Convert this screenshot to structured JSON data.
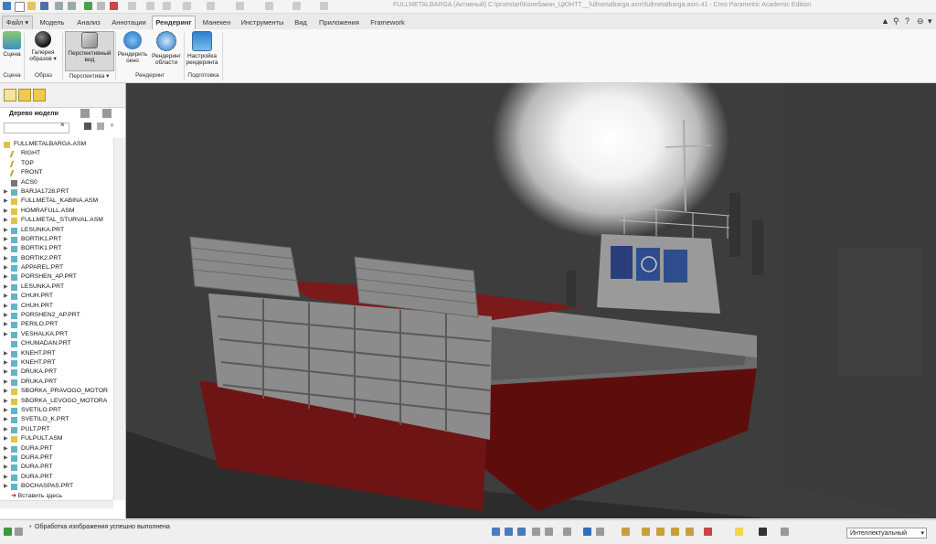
{
  "window": {
    "title": "FULLMETALBARGA (Активный) C:\\proestart\\Колебакин_ЦЮНТТ__fullmetalbarga.asm\\fullmetalbarga.asm.41 - Creo Parametric Academic Edition"
  },
  "tabs": [
    {
      "label": "Файл ▾"
    },
    {
      "label": "Модель"
    },
    {
      "label": "Анализ"
    },
    {
      "label": "Аннотации"
    },
    {
      "label": "Рендеринг"
    },
    {
      "label": "Манекен"
    },
    {
      "label": "Инструменты"
    },
    {
      "label": "Вид"
    },
    {
      "label": "Приложения"
    },
    {
      "label": "Framework"
    }
  ],
  "active_tab": "Рендеринг",
  "ribbon": {
    "buttons": [
      {
        "label": "Сцена",
        "icon": "scene-icon"
      },
      {
        "label": "Галерея образов ▾",
        "icon": "appearance-gallery-icon"
      },
      {
        "label": "Перспективный вид",
        "icon": "perspective-view-icon"
      },
      {
        "label": "Рендерить окно",
        "icon": "render-window-icon"
      },
      {
        "label": "Рендеринг области",
        "icon": "render-region-icon"
      },
      {
        "label": "Настройка рендеринга",
        "icon": "render-setup-icon"
      }
    ],
    "groups": [
      {
        "label": "Сцена"
      },
      {
        "label": "Образ"
      },
      {
        "label": "Перспектива ▾"
      },
      {
        "label": "Рендеринг"
      },
      {
        "label": "Подготовка"
      }
    ]
  },
  "left_panel": {
    "title": "Дерево модели",
    "insert_here": "Вставить здесь",
    "tree": [
      {
        "label": "FULLMETALBARGA.ASM",
        "type": "asm",
        "expand": ""
      },
      {
        "label": "RIGHT",
        "type": "plane",
        "expand": ""
      },
      {
        "label": "TOP",
        "type": "plane",
        "expand": ""
      },
      {
        "label": "FRONT",
        "type": "plane",
        "expand": ""
      },
      {
        "label": "ACS0",
        "type": "csys",
        "expand": ""
      },
      {
        "label": "BARJA1728.PRT",
        "type": "prt",
        "expand": "▶"
      },
      {
        "label": "FULLMETAL_KABINA.ASM",
        "type": "asm",
        "expand": "▶"
      },
      {
        "label": "HOMRAFULL.ASM",
        "type": "asm",
        "expand": "▶"
      },
      {
        "label": "FULLMETAL_STURVAL.ASM",
        "type": "asm",
        "expand": "▶"
      },
      {
        "label": "LESUNKA.PRT",
        "type": "prt",
        "expand": "▶"
      },
      {
        "label": "BORTIK1.PRT",
        "type": "prt",
        "expand": "▶"
      },
      {
        "label": "BORTIK1.PRT",
        "type": "prt",
        "expand": "▶"
      },
      {
        "label": "BORTIK2.PRT",
        "type": "prt",
        "expand": "▶"
      },
      {
        "label": "APPAREL.PRT",
        "type": "prt",
        "expand": "▶"
      },
      {
        "label": "PORSHEN_AP.PRT",
        "type": "prt",
        "expand": "▶"
      },
      {
        "label": "LESUNKA.PRT",
        "type": "prt",
        "expand": "▶"
      },
      {
        "label": "CHUH.PRT",
        "type": "prt",
        "expand": "▶"
      },
      {
        "label": "CHUH.PRT",
        "type": "prt",
        "expand": "▶"
      },
      {
        "label": "PORSHEN2_AP.PRT",
        "type": "prt",
        "expand": "▶"
      },
      {
        "label": "PERILO.PRT",
        "type": "prt",
        "expand": "▶"
      },
      {
        "label": "VESHALKA.PRT",
        "type": "prt",
        "expand": "▶"
      },
      {
        "label": "CHUMADAN.PRT",
        "type": "prt",
        "expand": ""
      },
      {
        "label": "KNEHT.PRT",
        "type": "prt",
        "expand": "▶"
      },
      {
        "label": "KNEHT.PRT",
        "type": "prt",
        "expand": "▶"
      },
      {
        "label": "DRUKA.PRT",
        "type": "prt",
        "expand": "▶"
      },
      {
        "label": "DRUKA.PRT",
        "type": "prt",
        "expand": "▶"
      },
      {
        "label": "SBORKA_PRAVOGO_MOTOR",
        "type": "asm",
        "expand": "▶"
      },
      {
        "label": "SBORKA_LEVOGO_MOTORA",
        "type": "asm",
        "expand": "▶"
      },
      {
        "label": "SVETILO.PRT",
        "type": "prt",
        "expand": "▶"
      },
      {
        "label": "SVETILO_K.PRT",
        "type": "prt",
        "expand": "▶"
      },
      {
        "label": "PULT.PRT",
        "type": "prt",
        "expand": "▶"
      },
      {
        "label": "FULPULT.ASM",
        "type": "asm",
        "expand": "▶"
      },
      {
        "label": "DURA.PRT",
        "type": "prt",
        "expand": "▶"
      },
      {
        "label": "DURA.PRT",
        "type": "prt",
        "expand": "▶"
      },
      {
        "label": "DURA.PRT",
        "type": "prt",
        "expand": "▶"
      },
      {
        "label": "DURA.PRT",
        "type": "prt",
        "expand": "▶"
      },
      {
        "label": "BOCHASPAS.PRT",
        "type": "prt",
        "expand": "▶"
      }
    ]
  },
  "status": {
    "message": "Обработка изображения успешно выполнена",
    "filter": "Интеллектуальный"
  },
  "colors": {
    "accent": "#2f6fbf",
    "hull_red": "#6e1212",
    "hull_gray": "#7d7d7d"
  }
}
